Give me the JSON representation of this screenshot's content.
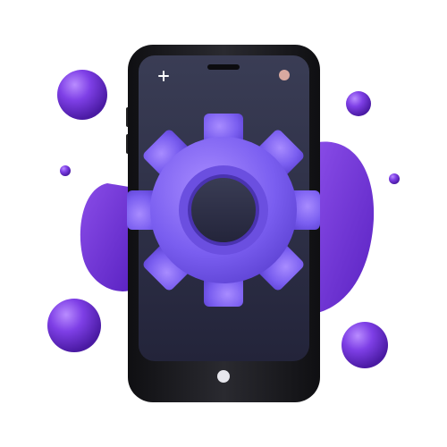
{
  "phone": {
    "status_bar": {
      "left_icon": "plus-icon",
      "right_icon": "camera-dot-icon"
    },
    "home_button_icon": "home-button-icon",
    "center_icon": "gear-icon"
  },
  "decorations": {
    "bubble_icon": "sphere-icon",
    "blob_icon": "blob-shape"
  },
  "colors": {
    "accent": "#7b4fe0",
    "accent_light": "#9a73f5",
    "accent_dark": "#5b2fc0",
    "phone_body": "#1b1b1f",
    "screen": "#2e3042",
    "background": "#ffffff"
  }
}
